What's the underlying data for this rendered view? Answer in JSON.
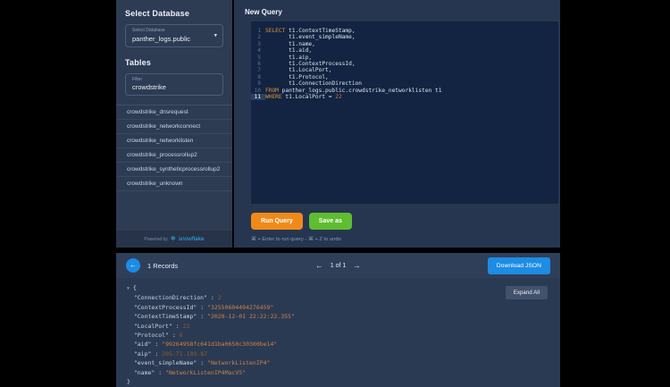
{
  "colors": {
    "accent_orange": "#ef8a19",
    "accent_green": "#5fbd31",
    "accent_blue": "#1d8ce4",
    "snowflake_blue": "#29b5e8",
    "panel_navy": "#2d3b53",
    "editor_navy": "#122441",
    "keyword_orange": "#e0913d"
  },
  "sidebar": {
    "title": "Select Database",
    "database_dropdown": {
      "label": "Select Database",
      "value": "panther_logs.public",
      "chevron_icon": "▾"
    },
    "tables_title": "Tables",
    "filter": {
      "label": "Filter",
      "value": "crowdstrike"
    },
    "tables": [
      "crowdstrike_dnsrequest",
      "crowdstrike_networkconnect",
      "crowdstrike_networklisten",
      "crowdstrike_processrollup2",
      "crowdstrike_syntheticprocessrollup2",
      "crowdstrike_unknown"
    ],
    "powered_by": {
      "prefix": "Powered by",
      "logo_icon": "❄",
      "brand": "snowflake"
    }
  },
  "query": {
    "title": "New Query",
    "run_button": "Run Query",
    "save_button": "Save as",
    "shortcut_hint": "⌘ + Enter to run query - ⌘ + Z to undo",
    "editor": {
      "active_line": 11,
      "lines": [
        {
          "num": 1,
          "parts": [
            [
              "kw",
              "SELECT"
            ],
            [
              "plain",
              " t1.ContextTimeStamp,"
            ]
          ]
        },
        {
          "num": 2,
          "parts": [
            [
              "plain",
              "       t1.event_simpleName,"
            ]
          ]
        },
        {
          "num": 3,
          "parts": [
            [
              "plain",
              "       t1.name,"
            ]
          ]
        },
        {
          "num": 4,
          "parts": [
            [
              "plain",
              "       t1.aid,"
            ]
          ]
        },
        {
          "num": 5,
          "parts": [
            [
              "plain",
              "       t1.aip,"
            ]
          ]
        },
        {
          "num": 6,
          "parts": [
            [
              "plain",
              "       t1.ContextProcessId,"
            ]
          ]
        },
        {
          "num": 7,
          "parts": [
            [
              "plain",
              "       t1.LocalPort,"
            ]
          ]
        },
        {
          "num": 8,
          "parts": [
            [
              "plain",
              "       t1.Protocol,"
            ]
          ]
        },
        {
          "num": 9,
          "parts": [
            [
              "plain",
              "       t1.ConnectionDirection"
            ]
          ]
        },
        {
          "num": 10,
          "parts": [
            [
              "kw",
              "FROM"
            ],
            [
              "plain",
              " panther_logs.public.crowdstrike_networklisten t1"
            ]
          ]
        },
        {
          "num": 11,
          "parts": [
            [
              "kw",
              "WHERE"
            ],
            [
              "plain",
              " t1.LocalPort = "
            ],
            [
              "numlit",
              "22"
            ]
          ]
        }
      ]
    }
  },
  "results": {
    "back_icon": "←",
    "records_label": "1 Records",
    "pagination": {
      "prev_icon": "←",
      "label": "1 of 1",
      "next_icon": "→"
    },
    "download_button": "Download JSON",
    "expand_button": "Expand All",
    "record": {
      "ConnectionDirection": 2,
      "ContextProcessId": "32550604494276459",
      "ContextTimeStamp": "2020-12-01 22:22:22.355",
      "LocalPort": 22,
      "Protocol": 6,
      "aid": "99264958fc641d1ba0650c30300be14",
      "aip": "205.71.189.87",
      "event_simpleName": "NetworkListenIP4",
      "name": "NetworkListenIP4MacV5"
    },
    "json_lines": [
      {
        "parts": [
          [
            "tri",
            "▼"
          ],
          [
            "brace",
            " {"
          ]
        ]
      },
      {
        "parts": [
          [
            "key",
            "  \"ConnectionDirection\""
          ],
          [
            "brace",
            " : "
          ],
          [
            "numval",
            "2"
          ]
        ]
      },
      {
        "parts": [
          [
            "key",
            "  \"ContextProcessId\""
          ],
          [
            "brace",
            " : "
          ],
          [
            "strval",
            "\"32550604494276459\""
          ]
        ]
      },
      {
        "parts": [
          [
            "key",
            "  \"ContextTimeStamp\""
          ],
          [
            "brace",
            " : "
          ],
          [
            "strval",
            "\"2020-12-01 22:22:22.355\""
          ]
        ]
      },
      {
        "parts": [
          [
            "key",
            "  \"LocalPort\""
          ],
          [
            "brace",
            " : "
          ],
          [
            "numval",
            "22"
          ]
        ]
      },
      {
        "parts": [
          [
            "key",
            "  \"Protocol\""
          ],
          [
            "brace",
            " : "
          ],
          [
            "numval",
            "6"
          ]
        ]
      },
      {
        "parts": [
          [
            "key",
            "  \"aid\""
          ],
          [
            "brace",
            " : "
          ],
          [
            "strval",
            "\"99264958fc641d1ba0650c30300be14\""
          ]
        ]
      },
      {
        "parts": [
          [
            "key",
            "  \"aip\""
          ],
          [
            "brace",
            " : "
          ],
          [
            "numval",
            "205.71.189.87"
          ]
        ]
      },
      {
        "parts": [
          [
            "key",
            "  \"event_simpleName\""
          ],
          [
            "brace",
            " : "
          ],
          [
            "strval",
            "\"NetworkListenIP4\""
          ]
        ]
      },
      {
        "parts": [
          [
            "key",
            "  \"name\""
          ],
          [
            "brace",
            " : "
          ],
          [
            "strval",
            "\"NetworkListenIP4MacV5\""
          ]
        ]
      },
      {
        "parts": [
          [
            "brace",
            "}"
          ]
        ]
      }
    ]
  }
}
